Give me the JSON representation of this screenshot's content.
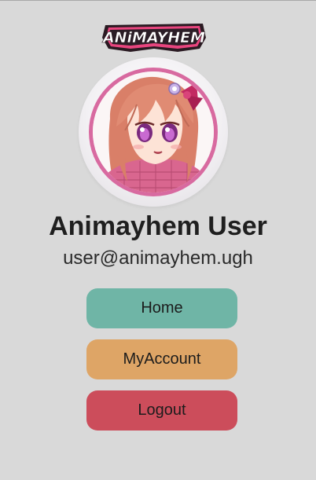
{
  "header": {
    "logo_text": "ANiMAYHEM"
  },
  "profile": {
    "avatar_icon": "anime-girl-avatar",
    "name": "Animayhem User",
    "email": "user@animayhem.ugh"
  },
  "menu": {
    "home_label": "Home",
    "account_label": "MyAccount",
    "logout_label": "Logout"
  },
  "colors": {
    "background": "#d9d9d9",
    "home": "#6fb5a6",
    "account": "#dea566",
    "logout": "#cc4d5b",
    "avatar_ring": "#d86aa0"
  }
}
